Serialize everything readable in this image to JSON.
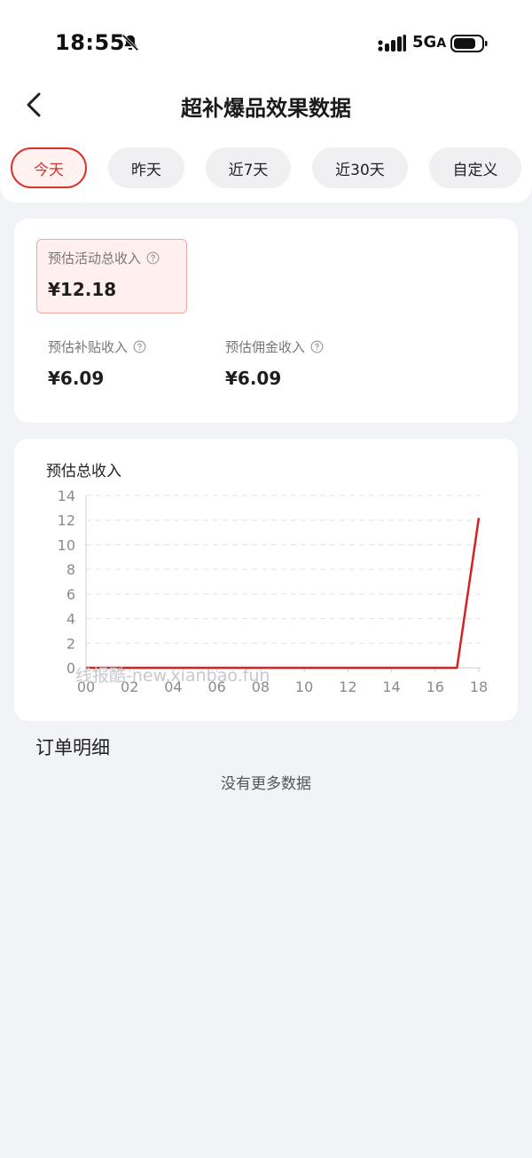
{
  "status_bar": {
    "time": "18:55",
    "network": "5G",
    "network_suffix": "A",
    "icons": [
      "bell-muted-icon",
      "signal-icon",
      "battery-icon"
    ]
  },
  "header": {
    "title": "超补爆品效果数据",
    "back_icon": "chevron-left-icon"
  },
  "tabs": [
    {
      "label": "今天",
      "active": true
    },
    {
      "label": "昨天",
      "active": false
    },
    {
      "label": "近7天",
      "active": false
    },
    {
      "label": "近30天",
      "active": false
    },
    {
      "label": "自定义",
      "active": false
    }
  ],
  "summary": {
    "total": {
      "label": "预估活动总收入",
      "value": "¥12.18"
    },
    "subsidy": {
      "label": "预估补贴收入",
      "value": "¥6.09"
    },
    "commission": {
      "label": "预估佣金收入",
      "value": "¥6.09"
    },
    "help_icon": "question-circle-icon"
  },
  "chart_data": {
    "type": "line",
    "title": "预估总收入",
    "x": [
      "00",
      "01",
      "02",
      "03",
      "04",
      "05",
      "06",
      "07",
      "08",
      "09",
      "10",
      "11",
      "12",
      "13",
      "14",
      "15",
      "16",
      "17",
      "18"
    ],
    "x_tick_labels": [
      "00",
      "02",
      "04",
      "06",
      "08",
      "10",
      "12",
      "14",
      "16",
      "18"
    ],
    "series": [
      {
        "values": [
          0,
          0,
          0,
          0,
          0,
          0,
          0,
          0,
          0,
          0,
          0,
          0,
          0,
          0,
          0,
          0,
          0,
          0,
          12.18
        ]
      }
    ],
    "xlabel": "",
    "ylabel": "",
    "ylim": [
      0,
      14
    ],
    "y_ticks": [
      0,
      2,
      4,
      6,
      8,
      10,
      12,
      14
    ],
    "grid": "horizontal-dashed",
    "line_color": "#d8211f"
  },
  "orders": {
    "title": "订单明细",
    "empty_text": "没有更多数据"
  },
  "watermark": "线报酷-new.xianbao.fun",
  "colors": {
    "accent": "#d8322a",
    "background": "#f2f3f7",
    "card": "#ffffff"
  }
}
